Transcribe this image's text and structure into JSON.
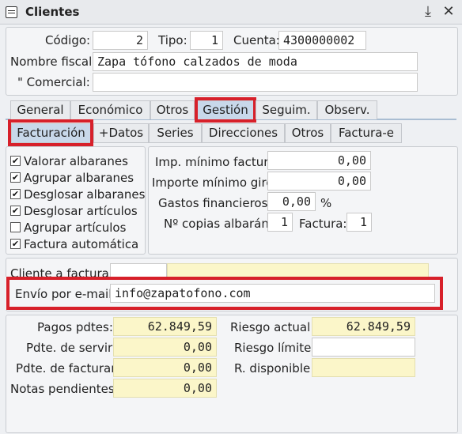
{
  "window": {
    "title": "Clientes",
    "pin_icon": "download-arrow-icon",
    "close_icon": "close-icon"
  },
  "header": {
    "codigo_label": "Código:",
    "codigo_value": "2",
    "tipo_label": "Tipo:",
    "tipo_value": "1",
    "cuenta_label": "Cuenta:",
    "cuenta_value": "4300000002",
    "nombre_fiscal_label": "Nombre fiscal:",
    "nombre_fiscal_value": "Zapa tófono calzados de moda",
    "comercial_label": "\" Comercial:",
    "comercial_value": ""
  },
  "tabs": [
    "General",
    "Económico",
    "Otros",
    "Gestión",
    "Seguim.",
    "Observ."
  ],
  "subtabs": [
    "Facturación",
    "+Datos",
    "Series",
    "Direcciones",
    "Otros",
    "Factura-e"
  ],
  "options": [
    {
      "label": "Valorar albaranes",
      "checked": true
    },
    {
      "label": "Agrupar albaranes",
      "checked": true
    },
    {
      "label": "Desglosar albaranes",
      "checked": true
    },
    {
      "label": "Desglosar artículos",
      "checked": true
    },
    {
      "label": "Agrupar artículos",
      "checked": false
    },
    {
      "label": "Factura automática",
      "checked": true
    }
  ],
  "importes": {
    "minimo_factura_label": "Imp. mínimo factura:",
    "minimo_factura_value": "0,00",
    "minimo_giro_label": "Importe mínimo giro:",
    "minimo_giro_value": "0,00",
    "gastos_label": "Gastos financieros:",
    "gastos_value": "0,00",
    "gastos_unit": "%",
    "copias_label": "Nº copias albarán:",
    "copias_value": "1",
    "factura_label": "Factura:",
    "factura_value": "1"
  },
  "cliente_facturar": {
    "label": "Cliente a facturar:",
    "code": "",
    "name": ""
  },
  "email": {
    "label": "Envío por e-mail:",
    "value": "info@zapatofono.com"
  },
  "resumen": {
    "pagos_label": "Pagos pdtes:",
    "pagos_value": "62.849,59",
    "servir_label": "Pdte. de servir:",
    "servir_value": "0,00",
    "facturar_label": "Pdte. de facturar:",
    "facturar_value": "0,00",
    "notas_label": "Notas pendientes:",
    "notas_value": "0,00",
    "riesgo_actual_label": "Riesgo actual:",
    "riesgo_actual_value": "62.849,59",
    "riesgo_limite_label": "Riesgo límite:",
    "riesgo_limite_value": "",
    "disponible_label": "R. disponible:",
    "disponible_value": ""
  }
}
